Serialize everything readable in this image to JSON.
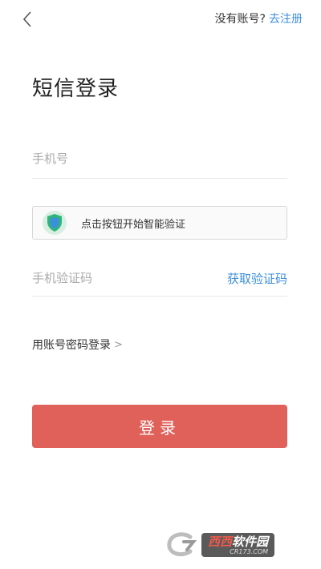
{
  "header": {
    "back_icon": "chevron-left-icon",
    "no_account_prompt": "没有账号?",
    "register_link": "去注册"
  },
  "page_title": "短信登录",
  "phone_field": {
    "placeholder": "手机号",
    "value": ""
  },
  "smart_verify": {
    "icon": "shield-icon",
    "label": "点击按钮开始智能验证"
  },
  "sms_code_field": {
    "placeholder": "手机验证码",
    "value": "",
    "get_code_label": "获取验证码"
  },
  "password_login_link": {
    "label": "用账号密码登录",
    "arrow": ">"
  },
  "login_button": {
    "label": "登录"
  },
  "watermark": {
    "brand_red": "西西",
    "brand_white": "软件园",
    "sub": "CR173.COM"
  },
  "colors": {
    "accent_blue": "#3d8fdb",
    "button_red": "#e0605a",
    "shield_green": "#2fb57a",
    "shield_blue": "#3d8fdb"
  }
}
